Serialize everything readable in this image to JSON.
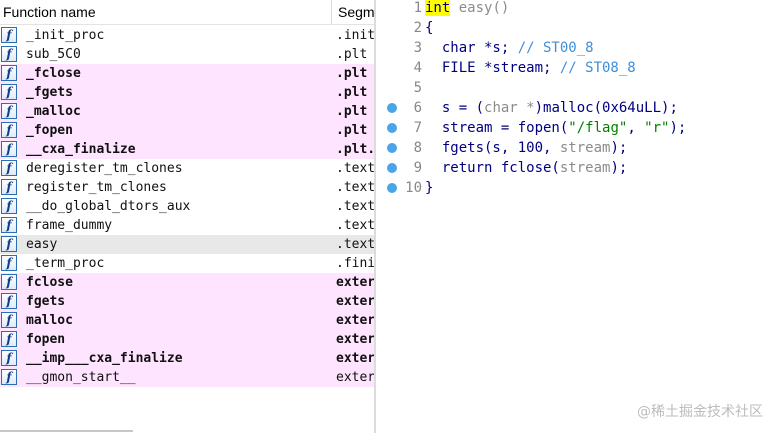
{
  "functions_window": {
    "columns": {
      "name": "Function name",
      "segment": "Segm"
    },
    "rows": [
      {
        "name": "_init_proc",
        "segment": ".init",
        "style": "normal"
      },
      {
        "name": "sub_5C0",
        "segment": ".plt",
        "style": "normal"
      },
      {
        "name": "_fclose",
        "segment": ".plt",
        "style": "pink-bold"
      },
      {
        "name": "_fgets",
        "segment": ".plt",
        "style": "pink-bold"
      },
      {
        "name": "_malloc",
        "segment": ".plt",
        "style": "pink-bold"
      },
      {
        "name": "_fopen",
        "segment": ".plt",
        "style": "pink-bold"
      },
      {
        "name": "__cxa_finalize",
        "segment": ".plt.",
        "style": "pink-bold"
      },
      {
        "name": "deregister_tm_clones",
        "segment": ".text",
        "style": "normal"
      },
      {
        "name": "register_tm_clones",
        "segment": ".text",
        "style": "normal"
      },
      {
        "name": "__do_global_dtors_aux",
        "segment": ".text",
        "style": "normal"
      },
      {
        "name": "frame_dummy",
        "segment": ".text",
        "style": "normal"
      },
      {
        "name": "easy",
        "segment": ".text",
        "style": "selected"
      },
      {
        "name": "_term_proc",
        "segment": ".fini",
        "style": "normal"
      },
      {
        "name": "fclose",
        "segment": "exter",
        "style": "pink-bold"
      },
      {
        "name": "fgets",
        "segment": "exter",
        "style": "pink-bold"
      },
      {
        "name": "malloc",
        "segment": "exter",
        "style": "pink-bold"
      },
      {
        "name": "fopen",
        "segment": "exter",
        "style": "pink-bold"
      },
      {
        "name": "__imp___cxa_finalize",
        "segment": "exter",
        "style": "pink-bold"
      },
      {
        "name": "__gmon_start__",
        "segment": "exter",
        "style": "pink"
      }
    ]
  },
  "pseudocode": {
    "lines": [
      {
        "num": "1",
        "breakpoint": false,
        "tokens": [
          [
            "int",
            "kw-hl"
          ],
          [
            " easy()",
            "grey"
          ]
        ]
      },
      {
        "num": "2",
        "breakpoint": false,
        "tokens": [
          [
            "{",
            ""
          ]
        ]
      },
      {
        "num": "3",
        "breakpoint": false,
        "tokens": [
          [
            "  char *s; ",
            ""
          ],
          [
            "// ST00_8",
            "cmt"
          ]
        ]
      },
      {
        "num": "4",
        "breakpoint": false,
        "tokens": [
          [
            "  FILE *stream; ",
            ""
          ],
          [
            "// ST08_8",
            "cmt"
          ]
        ]
      },
      {
        "num": "5",
        "breakpoint": false,
        "tokens": []
      },
      {
        "num": "6",
        "breakpoint": true,
        "tokens": [
          [
            "  s = (",
            ""
          ],
          [
            "char *",
            "grey"
          ],
          [
            ")malloc(0x64uLL);",
            ""
          ]
        ]
      },
      {
        "num": "7",
        "breakpoint": true,
        "tokens": [
          [
            "  stream = fopen(",
            ""
          ],
          [
            "\"/flag\"",
            "str"
          ],
          [
            ", ",
            ""
          ],
          [
            "\"r\"",
            "str"
          ],
          [
            ");",
            ""
          ]
        ]
      },
      {
        "num": "8",
        "breakpoint": true,
        "tokens": [
          [
            "  fgets(s, 100, ",
            ""
          ],
          [
            "stream",
            "grey"
          ],
          [
            ");",
            ""
          ]
        ]
      },
      {
        "num": "9",
        "breakpoint": true,
        "tokens": [
          [
            "  return fclose(",
            ""
          ],
          [
            "stream",
            "grey"
          ],
          [
            ");",
            ""
          ]
        ]
      },
      {
        "num": "10",
        "breakpoint": true,
        "tokens": [
          [
            "}",
            ""
          ]
        ]
      }
    ]
  },
  "watermark": "@稀土掘金技术社区",
  "icons": {
    "function": "function-icon",
    "breakpoint": "breakpoint-dot-icon"
  },
  "colors": {
    "import_row": "#fee4fe",
    "selected_row": "#e8e8e8",
    "code_text": "#000080",
    "breakpoint": "#49a4e8",
    "keyword_highlight": "#ffff00"
  }
}
